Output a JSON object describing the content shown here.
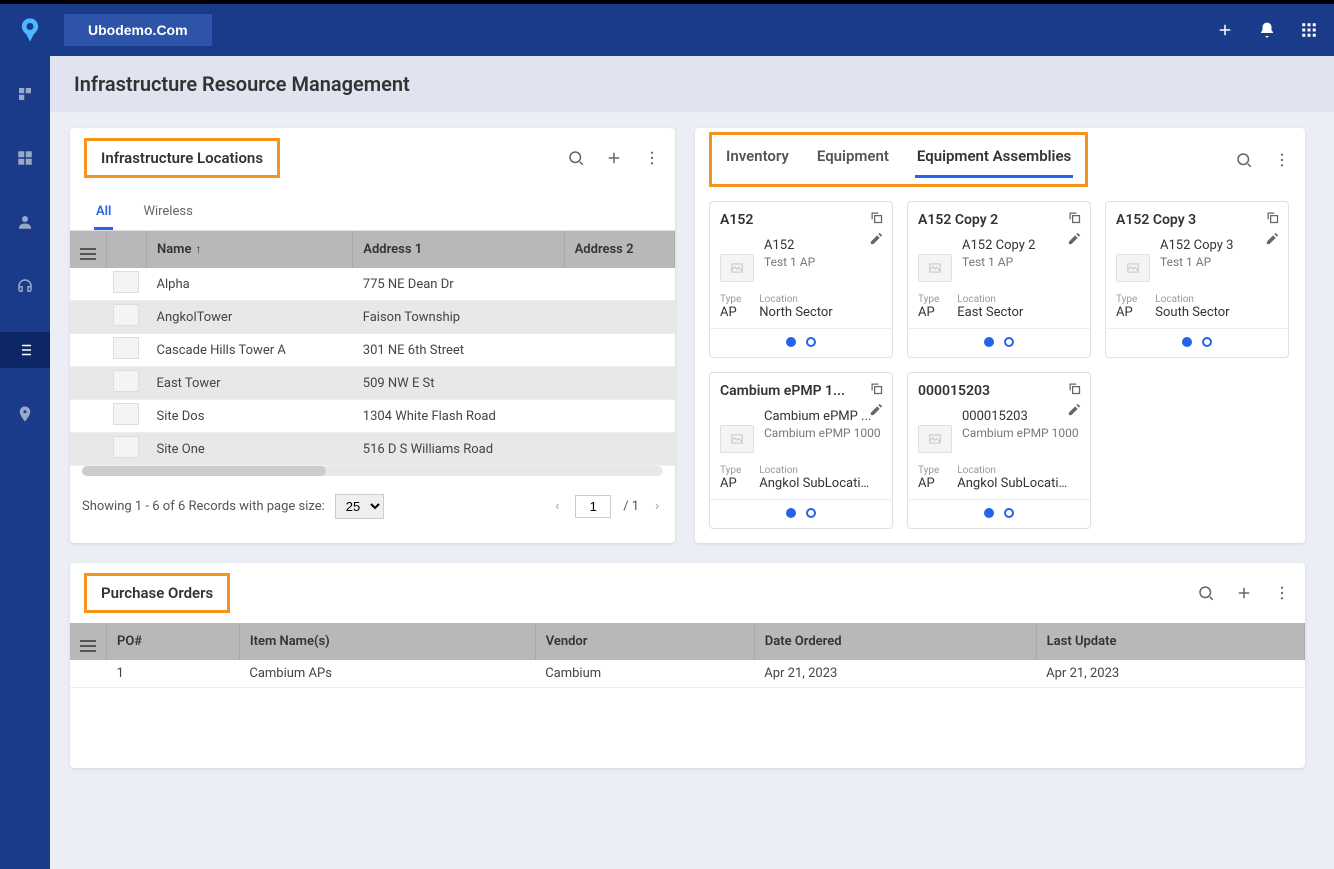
{
  "header": {
    "org": "Ubodemo.Com",
    "page_title": "Infrastructure Resource Management"
  },
  "locations_panel": {
    "title": "Infrastructure Locations",
    "tabs": [
      "All",
      "Wireless"
    ],
    "active_tab": 0,
    "columns": [
      "Name",
      "Address 1",
      "Address 2"
    ],
    "rows": [
      {
        "name": "Alpha",
        "addr1": "775 NE Dean Dr",
        "addr2": ""
      },
      {
        "name": "AngkolTower",
        "addr1": "Faison Township",
        "addr2": ""
      },
      {
        "name": "Cascade Hills Tower A",
        "addr1": "301 NE 6th Street",
        "addr2": ""
      },
      {
        "name": "East Tower",
        "addr1": "509 NW E St",
        "addr2": ""
      },
      {
        "name": "Site Dos",
        "addr1": "1304 White Flash Road",
        "addr2": ""
      },
      {
        "name": "Site One",
        "addr1": "516 D S Williams Road",
        "addr2": ""
      }
    ],
    "pager": {
      "text": "Showing 1 - 6 of 6 Records with page size:",
      "page_size": "25",
      "page": "1",
      "total_pages": "/ 1"
    }
  },
  "assemblies_panel": {
    "tabs": [
      "Inventory",
      "Equipment",
      "Equipment Assemblies"
    ],
    "active_tab": 2,
    "type_label": "Type",
    "location_label": "Location",
    "cards": [
      {
        "title": "A152",
        "name": "A152",
        "sub": "Test 1 AP",
        "type": "AP",
        "location": "North Sector"
      },
      {
        "title": "A152 Copy 2",
        "name": "A152 Copy 2",
        "sub": "Test 1 AP",
        "type": "AP",
        "location": "East Sector"
      },
      {
        "title": "A152 Copy 3",
        "name": "A152 Copy 3",
        "sub": "Test 1 AP",
        "type": "AP",
        "location": "South Sector"
      },
      {
        "title": "Cambium ePMP 1...",
        "name": "Cambium ePMP ...",
        "sub": "Cambium ePMP 1000",
        "type": "AP",
        "location": "Angkol SubLocati..."
      },
      {
        "title": "000015203",
        "name": "000015203",
        "sub": "Cambium ePMP 1000",
        "type": "AP",
        "location": "Angkol SubLocati..."
      }
    ]
  },
  "purchase_panel": {
    "title": "Purchase Orders",
    "columns": [
      "PO#",
      "Item Name(s)",
      "Vendor",
      "Date Ordered",
      "Last Update"
    ],
    "rows": [
      {
        "po": "1",
        "item": "Cambium APs",
        "vendor": "Cambium",
        "ordered": "Apr 21, 2023",
        "updated": "Apr 21, 2023"
      }
    ]
  }
}
